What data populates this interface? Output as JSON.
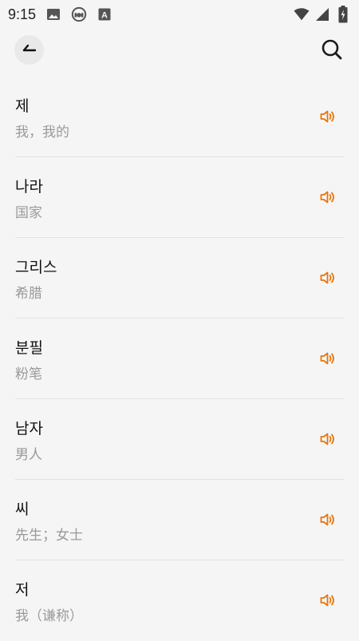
{
  "status_bar": {
    "time": "9:15",
    "icons": [
      "image-icon",
      "headset-icon",
      "font-icon",
      "wifi-icon",
      "signal-icon",
      "battery-icon"
    ]
  },
  "toolbar": {
    "back_icon": "back-arrow-icon",
    "search_icon": "search-icon"
  },
  "colors": {
    "accent": "#e8740c",
    "meaning_text": "#9a9a9a",
    "background": "#f5f5f5"
  },
  "words": [
    {
      "word": "제",
      "meaning": "我，我的"
    },
    {
      "word": "나라",
      "meaning": "国家"
    },
    {
      "word": "그리스",
      "meaning": "希腊"
    },
    {
      "word": "분필",
      "meaning": "粉笔"
    },
    {
      "word": "남자",
      "meaning": "男人"
    },
    {
      "word": "씨",
      "meaning": "先生；女士"
    },
    {
      "word": "저",
      "meaning": "我（谦称）"
    }
  ]
}
